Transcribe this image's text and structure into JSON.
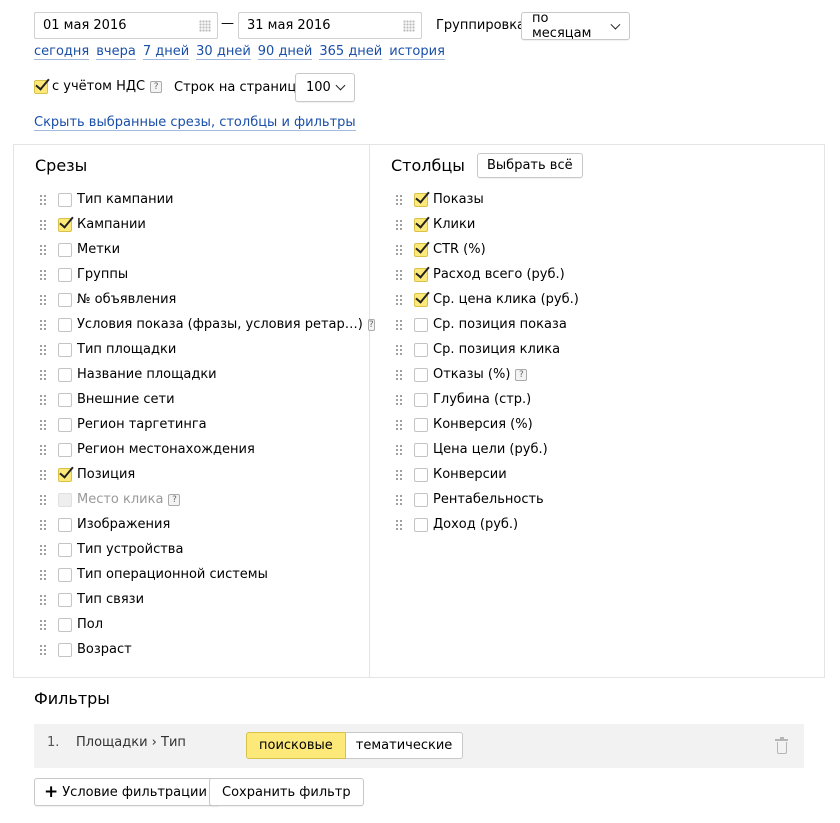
{
  "date_range": {
    "from": "01 мая 2016",
    "dash": "—",
    "to": "31 мая 2016"
  },
  "grouping": {
    "label": "Группировка",
    "value": "по месяцам"
  },
  "quick_periods": [
    "сегодня",
    "вчера",
    "7 дней",
    "30 дней",
    "90 дней",
    "365 дней",
    "история"
  ],
  "vat": {
    "label": "с учётом НДС",
    "checked": true,
    "help": "?"
  },
  "rows_per_page": {
    "label": "Строк на странице",
    "value": "100"
  },
  "hide_link": "Скрыть выбранные срезы, столбцы и фильтры",
  "slices": {
    "title": "Срезы",
    "items": [
      {
        "label": "Тип кампании",
        "checked": false
      },
      {
        "label": "Кампании",
        "checked": true
      },
      {
        "label": "Метки",
        "checked": false
      },
      {
        "label": "Группы",
        "checked": false
      },
      {
        "label": "№ объявления",
        "checked": false
      },
      {
        "label": "Условия показа (фразы, условия ретар…)",
        "checked": false,
        "help": true
      },
      {
        "label": "Тип площадки",
        "checked": false
      },
      {
        "label": "Название площадки",
        "checked": false
      },
      {
        "label": "Внешние сети",
        "checked": false
      },
      {
        "label": "Регион таргетинга",
        "checked": false
      },
      {
        "label": "Регион местонахождения",
        "checked": false
      },
      {
        "label": "Позиция",
        "checked": true
      },
      {
        "label": "Место клика",
        "checked": false,
        "disabled": true,
        "help": true
      },
      {
        "label": "Изображения",
        "checked": false
      },
      {
        "label": "Тип устройства",
        "checked": false
      },
      {
        "label": "Тип операционной системы",
        "checked": false
      },
      {
        "label": "Тип связи",
        "checked": false
      },
      {
        "label": "Пол",
        "checked": false
      },
      {
        "label": "Возраст",
        "checked": false
      }
    ]
  },
  "columns": {
    "title": "Столбцы",
    "select_all": "Выбрать всё",
    "items": [
      {
        "label": "Показы",
        "checked": true
      },
      {
        "label": "Клики",
        "checked": true
      },
      {
        "label": "CTR (%)",
        "checked": true
      },
      {
        "label": "Расход всего (руб.)",
        "checked": true
      },
      {
        "label": "Ср. цена клика (руб.)",
        "checked": true
      },
      {
        "label": "Ср. позиция показа",
        "checked": false
      },
      {
        "label": "Ср. позиция клика",
        "checked": false
      },
      {
        "label": "Отказы (%)",
        "checked": false,
        "help": true
      },
      {
        "label": "Глубина (стр.)",
        "checked": false
      },
      {
        "label": "Конверсия (%)",
        "checked": false
      },
      {
        "label": "Цена цели (руб.)",
        "checked": false
      },
      {
        "label": "Конверсии",
        "checked": false
      },
      {
        "label": "Рентабельность",
        "checked": false
      },
      {
        "label": "Доход (руб.)",
        "checked": false
      }
    ]
  },
  "filters": {
    "title": "Фильтры",
    "rows": [
      {
        "index": "1.",
        "path": "Площадки › Тип",
        "options": [
          {
            "label": "поисковые",
            "active": true
          },
          {
            "label": "тематические",
            "active": false
          }
        ]
      }
    ],
    "add_condition": "Условие фильтрации",
    "add_icon": "+",
    "save_filter": "Сохранить фильтр"
  },
  "colors": {
    "link": "#1a4fa8",
    "check_fill": "#fde87a",
    "active_option": "#fde87a",
    "filter_row_bg": "#f2f2f2"
  }
}
